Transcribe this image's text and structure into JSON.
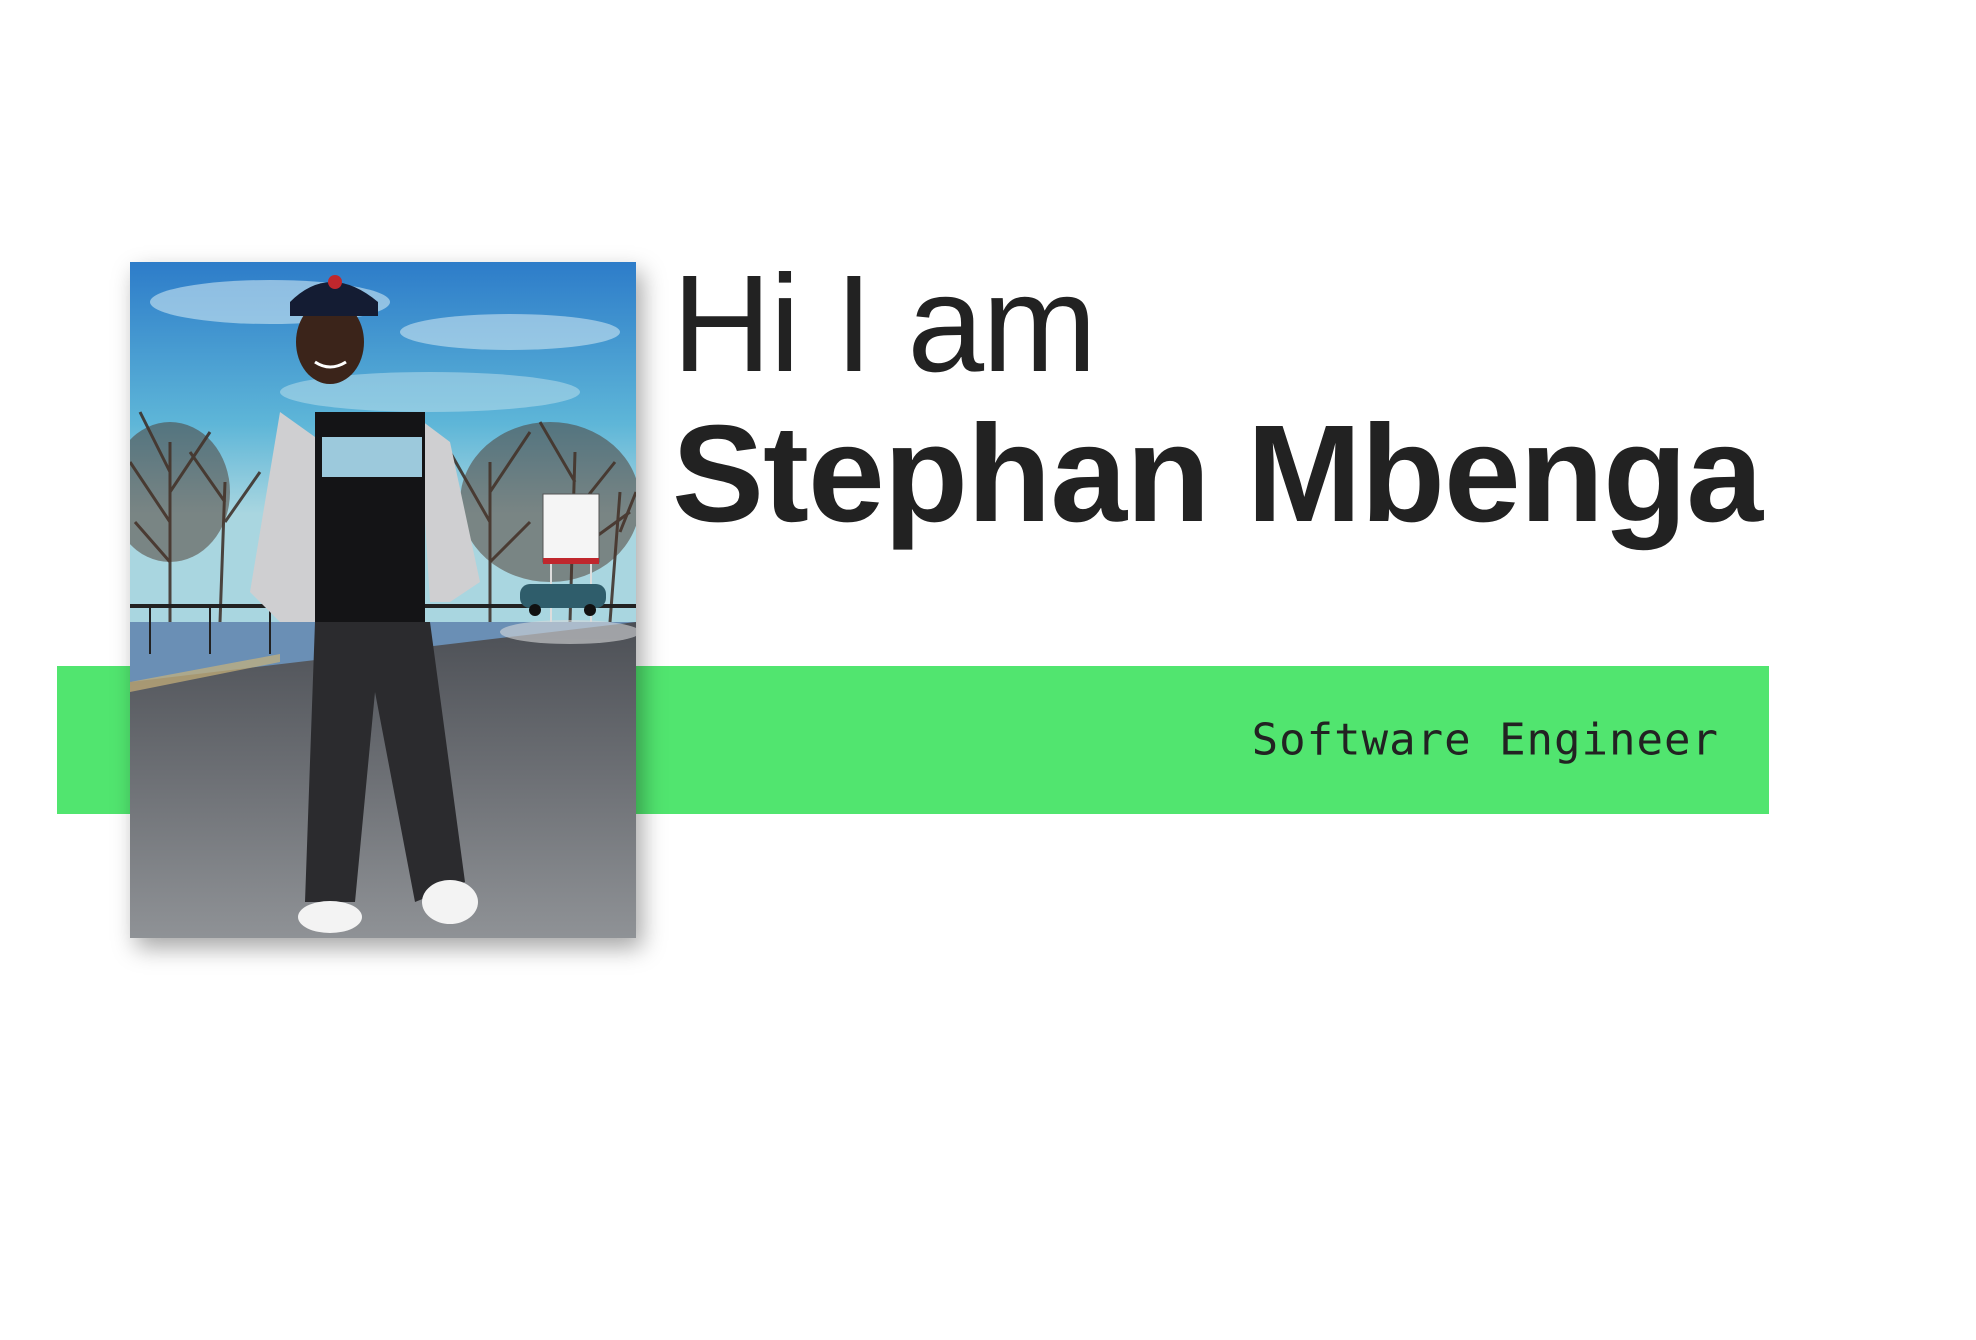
{
  "hero": {
    "greeting": "Hi I am",
    "name": "Stephan Mbenga",
    "role": "Software Engineer",
    "photo_alt": "Portrait of Stephan Mbenga standing in a parking lot"
  },
  "colors": {
    "accent": "#51e56f",
    "text": "#222222",
    "background": "#ffffff"
  }
}
